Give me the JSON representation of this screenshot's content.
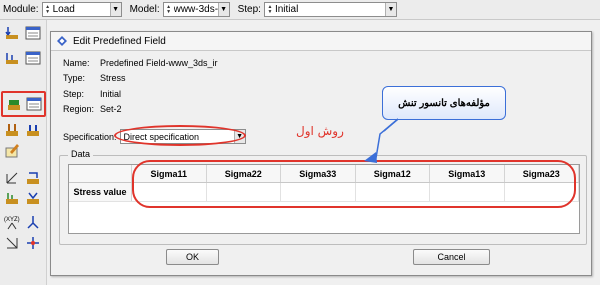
{
  "toolbar": {
    "module_label": "Module:",
    "module_value": "Load",
    "model_label": "Model:",
    "model_value": "www-3ds-ir",
    "step_label": "Step:",
    "step_value": "Initial"
  },
  "dialog": {
    "title": "Edit Predefined Field",
    "info": [
      {
        "key": "Name:",
        "value": "Predefined Field-www_3ds_ir"
      },
      {
        "key": "Type:",
        "value": "Stress"
      },
      {
        "key": "Step:",
        "value": "Initial"
      },
      {
        "key": "Region:",
        "value": "Set-2"
      }
    ],
    "specification_label": "Specification:",
    "specification_value": "Direct specification",
    "data_group_label": "Data",
    "columns": [
      "Sigma11",
      "Sigma22",
      "Sigma33",
      "Sigma12",
      "Sigma13",
      "Sigma23"
    ],
    "row_header": "Stress value",
    "ok_label": "OK",
    "cancel_label": "Cancel"
  },
  "annotations": {
    "callout_text": "مؤلفه‌های تانسور تنش",
    "ravesh_text": "روش اول",
    "annotation_color": "#e0342b"
  }
}
